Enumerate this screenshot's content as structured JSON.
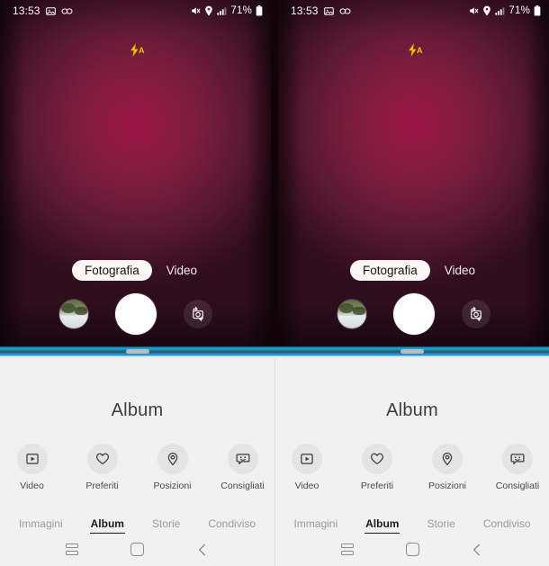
{
  "panels": [
    {
      "id": "left",
      "status_bar": {
        "time": "13:53",
        "left_icons": [
          "image-icon",
          "infinity-icon"
        ],
        "right_icons": [
          "mute-icon",
          "location-pin-icon",
          "signal-bars-icon"
        ],
        "battery_percent": "71%"
      },
      "camera": {
        "flash_mode_label": "A",
        "flash_icon": "flash-auto-icon",
        "modes": [
          {
            "label": "Fotografia",
            "active": true
          },
          {
            "label": "Video",
            "active": false
          }
        ],
        "thumbnail_name": "last-photo-thumbnail",
        "shutter_name": "shutter-button",
        "flip_icon": "camera-switch-icon"
      },
      "divider": {
        "handle_name": "split-screen-handle"
      },
      "gallery": {
        "title": "Album",
        "quick_actions": [
          {
            "label": "Video",
            "icon": "video-play-icon"
          },
          {
            "label": "Preferiti",
            "icon": "heart-icon"
          },
          {
            "label": "Posizioni",
            "icon": "location-pin-icon"
          },
          {
            "label": "Consigliati",
            "icon": "suggestion-bubble-icon"
          }
        ],
        "tabs": [
          {
            "label": "Immagini",
            "active": false
          },
          {
            "label": "Album",
            "active": true
          },
          {
            "label": "Storie",
            "active": false
          },
          {
            "label": "Condiviso",
            "active": false
          }
        ]
      },
      "navbar": {
        "recents_label": "recents-button",
        "home_label": "home-button",
        "back_label": "back-button"
      }
    },
    {
      "id": "right",
      "status_bar": {
        "time": "13:53",
        "left_icons": [
          "image-icon",
          "infinity-icon"
        ],
        "right_icons": [
          "mute-icon",
          "location-pin-icon",
          "signal-bars-icon"
        ],
        "battery_percent": "71%"
      },
      "camera": {
        "flash_mode_label": "A",
        "flash_icon": "flash-auto-icon",
        "modes": [
          {
            "label": "Fotografia",
            "active": true
          },
          {
            "label": "Video",
            "active": false
          }
        ],
        "thumbnail_name": "last-photo-thumbnail",
        "shutter_name": "shutter-button",
        "flip_icon": "camera-switch-icon"
      },
      "divider": {
        "handle_name": "split-screen-handle"
      },
      "gallery": {
        "title": "Album",
        "quick_actions": [
          {
            "label": "Video",
            "icon": "video-play-icon"
          },
          {
            "label": "Preferiti",
            "icon": "heart-icon"
          },
          {
            "label": "Posizioni",
            "icon": "location-pin-icon"
          },
          {
            "label": "Consigliati",
            "icon": "suggestion-bubble-icon"
          }
        ],
        "tabs": [
          {
            "label": "Immagini",
            "active": false
          },
          {
            "label": "Album",
            "active": true
          },
          {
            "label": "Storie",
            "active": false
          },
          {
            "label": "Condiviso",
            "active": false
          }
        ]
      },
      "navbar": {
        "recents_label": "recents-button",
        "home_label": "home-button",
        "back_label": "back-button"
      }
    }
  ],
  "colors": {
    "camera_background_center": "#9e1545",
    "camera_background_edge": "#2e0d1c",
    "flash_accent": "#f2c200",
    "divider_accent": "#1f9ed4",
    "gallery_background": "#f1f1f1",
    "tab_active": "#1a1a1a",
    "tab_inactive": "#9b9b9b"
  }
}
